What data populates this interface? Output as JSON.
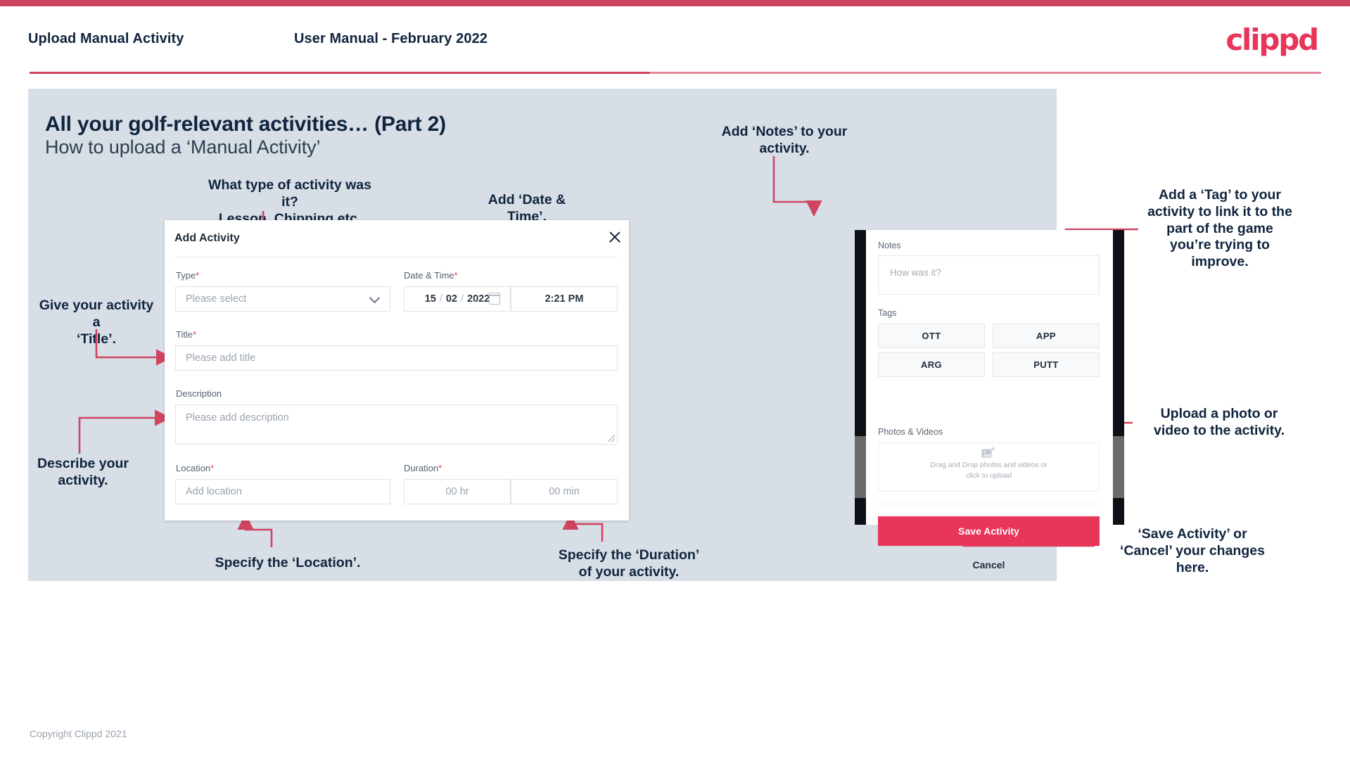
{
  "header": {
    "title": "Upload Manual Activity",
    "subtitle": "User Manual - February 2022",
    "logo": "clippd",
    "accent": "#e8355a",
    "bar_color": "#cf4460"
  },
  "slide": {
    "heading": "All your golf-relevant activities… (Part 2)",
    "subheading": "How to upload a ‘Manual Activity’",
    "background": "#d7dee6"
  },
  "callouts": {
    "type": "What type of activity was it?\nLesson, Chipping etc.",
    "type_line1": "What type of activity was it?",
    "type_line2": "Lesson, Chipping etc.",
    "datetime": "Add ‘Date & Time’.",
    "title": "Give your activity a\n‘Title’.",
    "title_line1": "Give your activity a",
    "title_line2": "‘Title’.",
    "description_line1": "Describe your",
    "description_line2": "activity.",
    "location": "Specify the ‘Location’.",
    "duration_line1": "Specify the ‘Duration’",
    "duration_line2": "of your activity.",
    "notes_line1": "Add ‘Notes’ to your",
    "notes_line2": "activity.",
    "tag": "Add a ‘Tag’ to your activity to link it to the part of the game you’re trying to improve.",
    "upload_line1": "Upload a photo or",
    "upload_line2": "video to the activity.",
    "save_line1": "‘Save Activity’ or",
    "save_line2": "‘Cancel’ your changes",
    "save_line3": "here."
  },
  "modal": {
    "title": "Add Activity",
    "close_icon": "close-icon",
    "fields": {
      "type": {
        "label": "Type",
        "required": "*",
        "placeholder": "Please select",
        "icon": "chevron-down-icon"
      },
      "datetime": {
        "label": "Date & Time",
        "required": "*",
        "day": "15",
        "sep1": "/",
        "month": "02",
        "sep2": "/",
        "year": "2022",
        "icon": "calendar-icon",
        "time": "2:21 PM"
      },
      "title": {
        "label": "Title",
        "required": "*",
        "placeholder": "Please add title"
      },
      "description": {
        "label": "Description",
        "placeholder": "Please add description"
      },
      "location": {
        "label": "Location",
        "required": "*",
        "placeholder": "Add location"
      },
      "duration": {
        "label": "Duration",
        "required": "*",
        "hours_placeholder": "00 hr",
        "minutes_placeholder": "00 min"
      }
    }
  },
  "phone": {
    "notes": {
      "label": "Notes",
      "placeholder": "How was it?"
    },
    "tags": {
      "label": "Tags",
      "items": [
        "OTT",
        "APP",
        "ARG",
        "PUTT"
      ]
    },
    "photos": {
      "label": "Photos & Videos",
      "icon": "add-image-icon",
      "drop_line1": "Drag and Drop photos and videos or",
      "drop_line2": "click to upload"
    },
    "save_label": "Save Activity",
    "cancel_label": "Cancel",
    "save_color": "#e8355a"
  },
  "footer": {
    "copyright": "Copyright Clippd 2021"
  }
}
